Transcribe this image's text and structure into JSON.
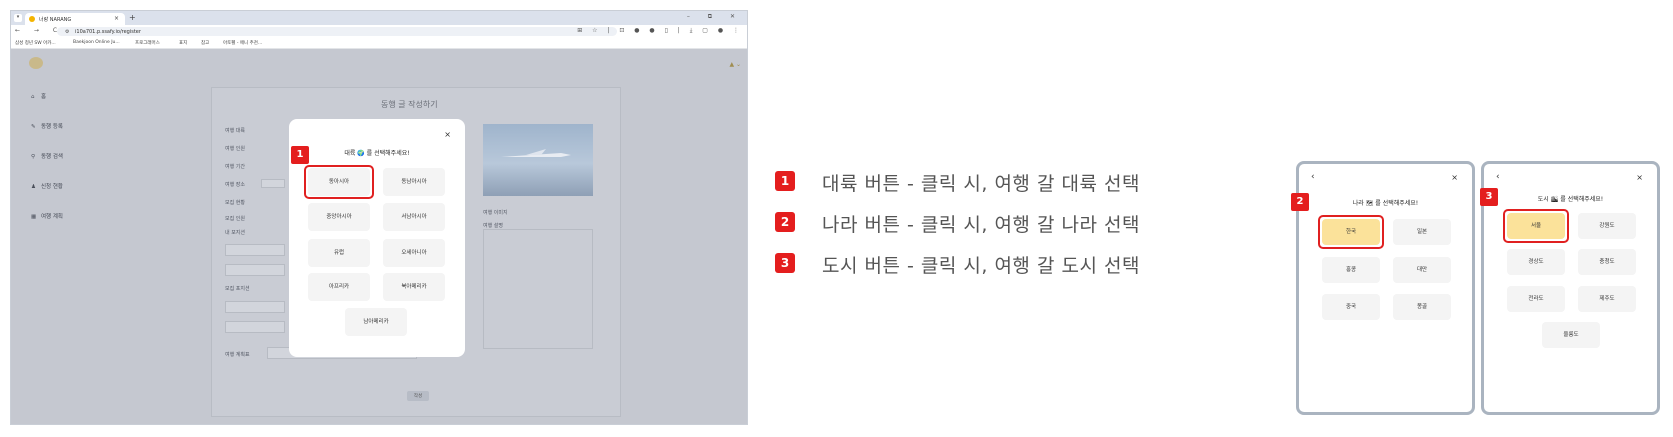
{
  "browser": {
    "tab_title": "너랑 NARANG",
    "new_tab": "+",
    "tab_close": "×",
    "window_controls": "–  ⧉  ✕",
    "url": "i10a701.p.ssafy.io/register",
    "nav_icons": "←  →  C",
    "extensions": "⊞ ☆ | ⊡ ● ● ▯ | ⤓ ▢ ● ⋮",
    "bookmarks": [
      "삼성 청년 SW 아카...",
      "Baekjoon Online Ju...",
      "프로그래머스",
      "표지",
      "참고",
      "아토펠 - 애니 추천..."
    ]
  },
  "app": {
    "page_title": "동행 글 작성하기",
    "topright": "▲  ⌄",
    "sidebar": [
      {
        "icon": "⌂",
        "label": "홈"
      },
      {
        "icon": "✎",
        "label": "동행 등록"
      },
      {
        "icon": "⚲",
        "label": "동행 검색"
      },
      {
        "icon": "♟",
        "label": "신청 현황"
      },
      {
        "icon": "▦",
        "label": "여행 계획"
      }
    ],
    "form_labels": [
      "여행 대륙",
      "여행 인원",
      "여행 기간",
      "여행 장소",
      "모집 현황",
      "모집 인원",
      "내 포지션",
      "",
      "",
      "모집 포지션",
      "",
      "",
      "여행 계획표"
    ],
    "submit": "작성",
    "photo_caption": "여행 이미지",
    "photo_desc_label": "여행 설명"
  },
  "modal": {
    "title": "대륙 🌍 를 선택해주세요!",
    "close": "×",
    "buttons": [
      "동아시아",
      "동남아시아",
      "중앙아시아",
      "서남아시아",
      "유럽",
      "오세아니아",
      "아프리카",
      "북아메리카",
      "남아메리카"
    ],
    "badge": "1"
  },
  "legend": [
    {
      "badge": "1",
      "text": "대륙 버튼 - 클릭 시, 여행 갈 대륙 선택"
    },
    {
      "badge": "2",
      "text": "나라 버튼 - 클릭 시, 여행 갈 나라 선택"
    },
    {
      "badge": "3",
      "text": "도시 버튼 - 클릭 시, 여행 갈 도시 선택"
    }
  ],
  "country_card": {
    "title": "나라 🗺 를 선택해주세요!",
    "back": "‹",
    "close": "×",
    "badge": "2",
    "buttons": [
      "한국",
      "일본",
      "홍콩",
      "대만",
      "중국",
      "몽골"
    ]
  },
  "city_card": {
    "title": "도시 🏙 를 선택해주세요!",
    "back": "‹",
    "close": "×",
    "badge": "3",
    "buttons": [
      "서울",
      "강원도",
      "경상도",
      "충청도",
      "전라도",
      "제주도",
      "울릉도"
    ]
  },
  "colors": {
    "highlight_fill": "#fbe29a",
    "badge_red": "#e41e1e",
    "highlight_border": "#e02020"
  }
}
